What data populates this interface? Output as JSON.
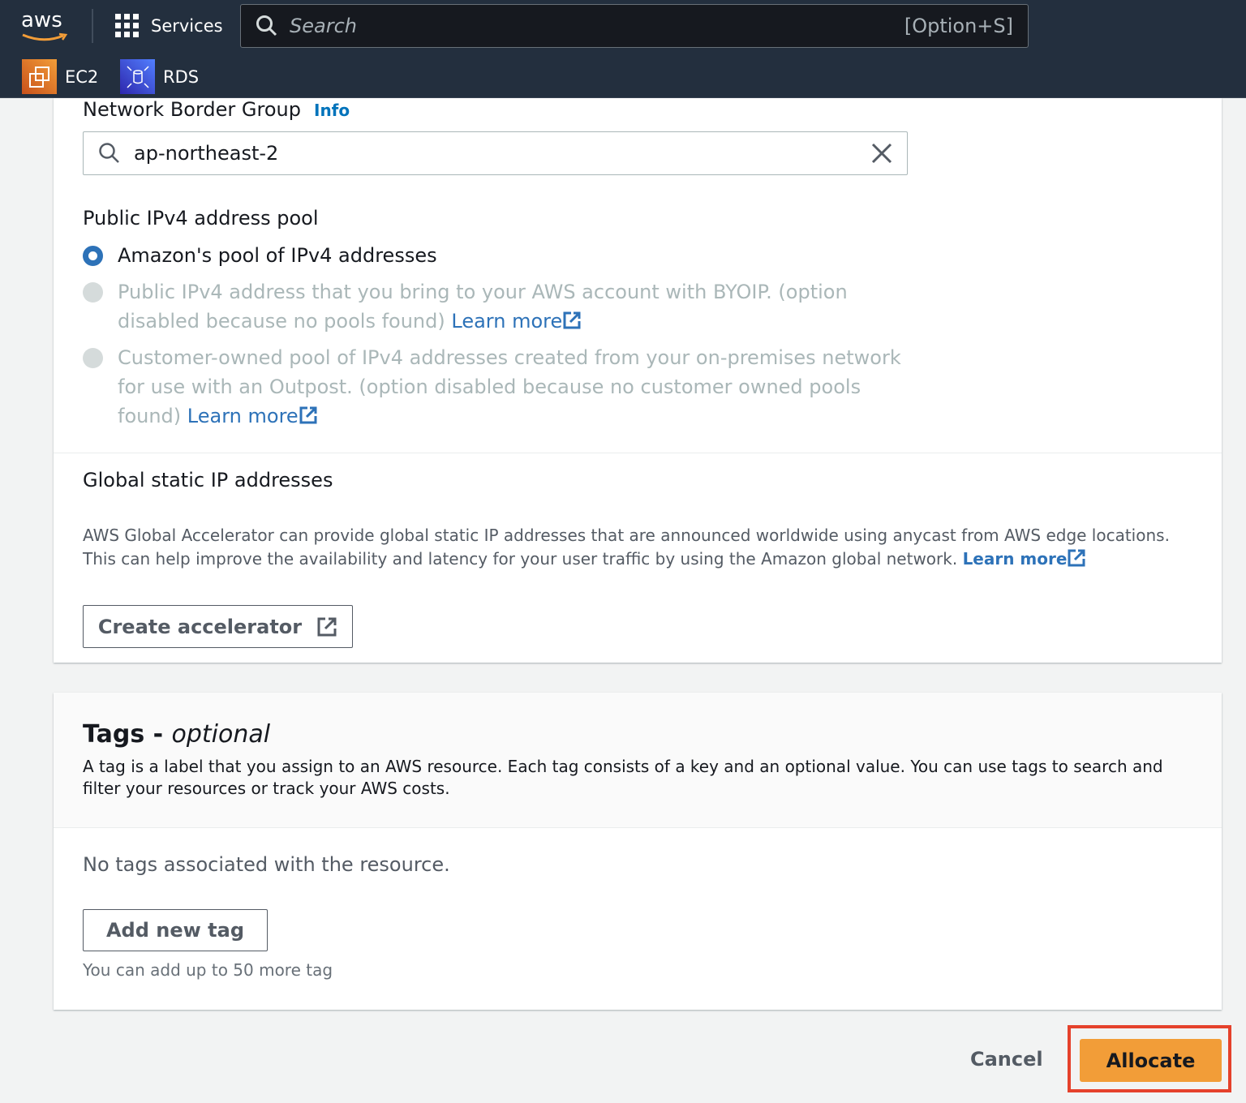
{
  "nav": {
    "logo": "aws",
    "services": "Services",
    "search_placeholder": "Search",
    "search_shortcut": "[Option+S]",
    "favorites": [
      {
        "label": "EC2",
        "icon": "ec2-icon",
        "color": "#e07b28"
      },
      {
        "label": "RDS",
        "icon": "rds-icon",
        "color": "#3b48cc"
      }
    ]
  },
  "network_border_group": {
    "label": "Network Border Group",
    "info": "Info",
    "value": "ap-northeast-2"
  },
  "pool": {
    "label": "Public IPv4 address pool",
    "options": [
      {
        "text": "Amazon's pool of IPv4 addresses",
        "selected": true,
        "disabled": false
      },
      {
        "text": "Public IPv4 address that you bring to your AWS account with BYOIP. (option disabled because no pools found)",
        "link": "Learn more",
        "selected": false,
        "disabled": true
      },
      {
        "text": "Customer-owned pool of IPv4 addresses created from your on-premises network for use with an Outpost. (option disabled because no customer owned pools found)",
        "link": "Learn more",
        "selected": false,
        "disabled": true
      }
    ]
  },
  "global": {
    "title": "Global static IP addresses",
    "description": "AWS Global Accelerator can provide global static IP addresses that are announced worldwide using anycast from AWS edge locations. This can help improve the availability and latency for your user traffic by using the Amazon global network.",
    "link": "Learn more",
    "button": "Create accelerator"
  },
  "tags": {
    "title": "Tags",
    "title_suffix": " - ",
    "optional": "optional",
    "description": "A tag is a label that you assign to an AWS resource. Each tag consists of a key and an optional value. You can use tags to search and filter your resources or track your AWS costs.",
    "empty": "No tags associated with the resource.",
    "add_button": "Add new tag",
    "limit": "You can add up to 50 more tag"
  },
  "footer": {
    "cancel": "Cancel",
    "allocate": "Allocate"
  },
  "colors": {
    "accent": "#2d72b8",
    "primary_button": "#f29d38",
    "highlight": "#e5412b",
    "header": "#232f3e"
  }
}
